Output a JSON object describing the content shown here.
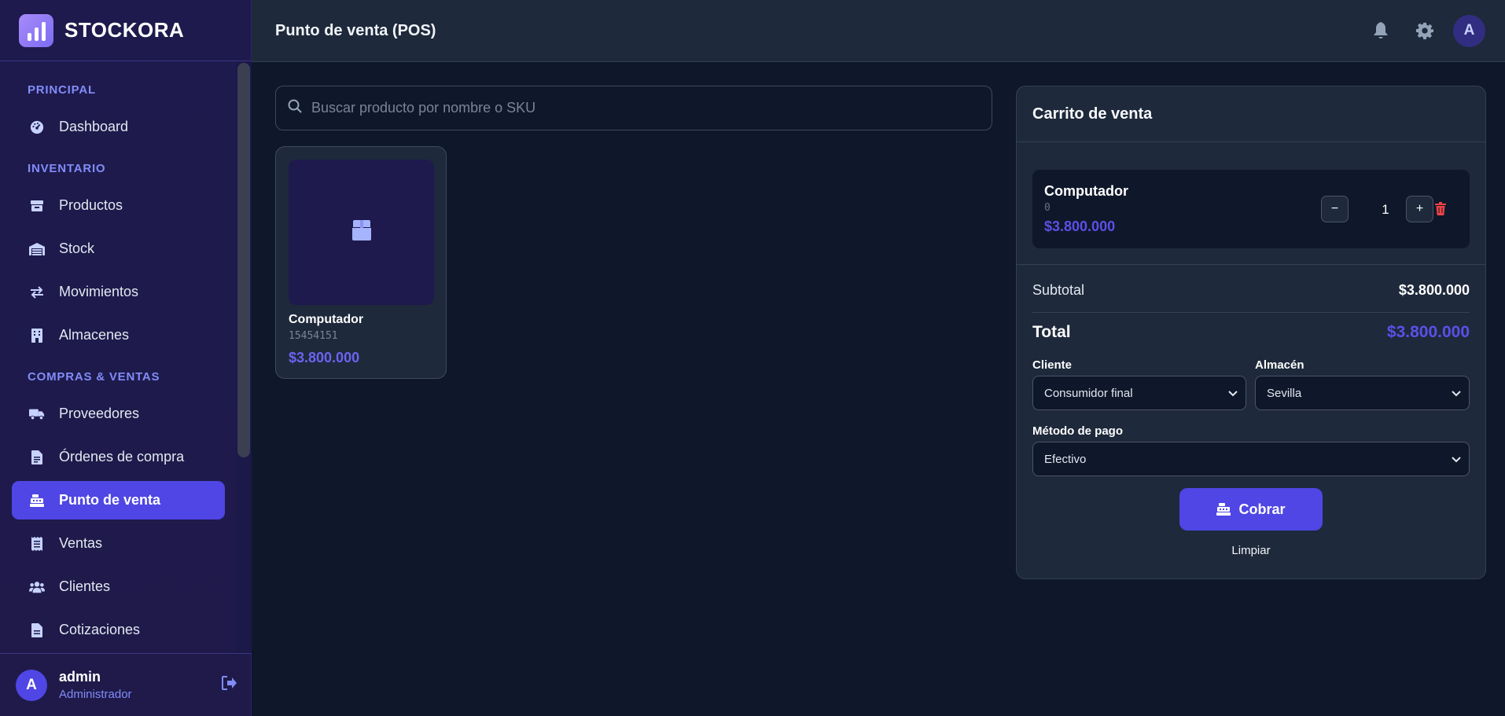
{
  "app": {
    "brand": "STOCKORA"
  },
  "sidebar": {
    "sections": {
      "principal": "PRINCIPAL",
      "inventario": "INVENTARIO",
      "compras_ventas": "COMPRAS & VENTAS"
    },
    "items": {
      "dashboard": "Dashboard",
      "productos": "Productos",
      "stock": "Stock",
      "movimientos": "Movimientos",
      "almacenes": "Almacenes",
      "proveedores": "Proveedores",
      "ordenes": "Órdenes de compra",
      "pos": "Punto de venta",
      "ventas": "Ventas",
      "clientes": "Clientes",
      "cotizaciones": "Cotizaciones"
    },
    "active_item": "pos",
    "user": {
      "initial": "A",
      "name": "admin",
      "role": "Administrador"
    }
  },
  "header": {
    "title": "Punto de venta (POS)",
    "avatar_initial": "A",
    "icons": [
      "bell-icon",
      "gear-icon"
    ]
  },
  "search": {
    "placeholder": "Buscar producto por nombre o SKU",
    "value": ""
  },
  "products": [
    {
      "name": "Computador",
      "sku": "15454151",
      "price": "$3.800.000",
      "icon": "box-icon"
    }
  ],
  "cart": {
    "title": "Carrito de venta",
    "items": [
      {
        "name": "Computador",
        "sku": "0",
        "price": "$3.800.000",
        "qty": "1"
      }
    ],
    "subtotal_label": "Subtotal",
    "subtotal_value": "$3.800.000",
    "total_label": "Total",
    "total_value": "$3.800.000",
    "cliente_label": "Cliente",
    "cliente_value": "Consumidor final",
    "almacen_label": "Almacén",
    "almacen_value": "Sevilla",
    "pago_label": "Método de pago",
    "pago_value": "Efectivo",
    "pay_button": "Cobrar",
    "clear_button": "Limpiar",
    "minus": "−",
    "plus": "+"
  },
  "colors": {
    "accent": "#4f46e5",
    "price": "#5b50e8",
    "danger": "#ef4444",
    "sidebar_bg": "#1e1a4d",
    "main_bg": "#0f172a"
  }
}
